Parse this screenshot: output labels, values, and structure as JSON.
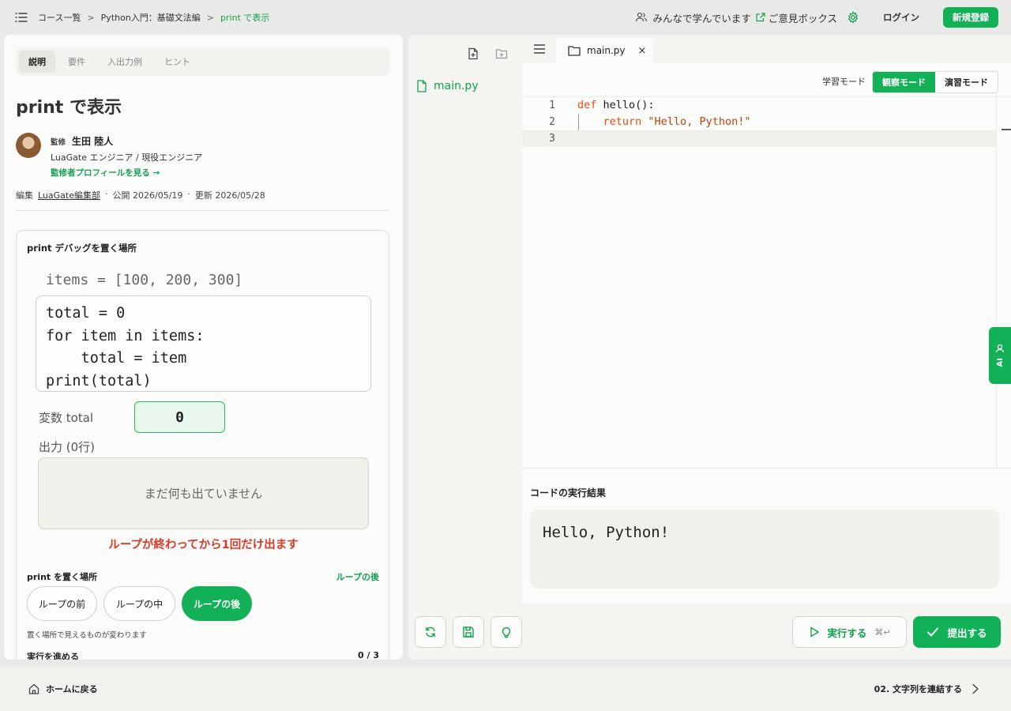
{
  "breadcrumb": {
    "items": [
      "コース一覧",
      "Python入門：基礎文法編"
    ],
    "current": "print で表示"
  },
  "header": {
    "community": "みんなで学んでいます",
    "feedback": "ご意見ボックス",
    "login": "ログイン",
    "signup": "新規登録",
    "accent": "#12b157"
  },
  "lesson": {
    "tabs": [
      "説明",
      "要件",
      "入出力例",
      "ヒント"
    ],
    "active_tab": "説明",
    "title": "print で表示",
    "supervisor": {
      "label": "監修",
      "name": "生田 陸人",
      "role": "LuaGate エンジニア / 現役エンジニア",
      "profile_link": "監修者プロフィールを見る →"
    },
    "meta": {
      "editor_label": "編集",
      "editor": "LuaGate編集部",
      "published": "公開 2026/05/19",
      "updated": "更新 2026/05/28",
      "dot": "·"
    }
  },
  "demo": {
    "title": "print デバッグを置く場所",
    "pre_line": "items = [100, 200, 300]",
    "code_lines": [
      "total = 0",
      "for item in items:",
      "    total = item",
      "print(total)"
    ],
    "var_label": "変数 total",
    "var_value": "0",
    "output_label": "出力 (0行)",
    "output_empty": "まだ何も出ていません",
    "note": "ループが終わってから1回だけ出ます",
    "place_label": "print を置く場所",
    "place_value": "ループの後",
    "place_options": [
      "ループの前",
      "ループの中",
      "ループの後"
    ],
    "place_hint": "置く場所で見えるものが変わります",
    "step_label": "実行を進める",
    "step_count": "0 / 3"
  },
  "editor": {
    "file_name": "main.py",
    "tab_close": "×",
    "mode_label": "学習モード",
    "modes": [
      "観察モード",
      "演習モード"
    ],
    "active_mode": "観察モード",
    "lines": [
      {
        "n": "1",
        "parts": [
          [
            "kw",
            "def "
          ],
          [
            "fn",
            "hello():"
          ]
        ]
      },
      {
        "n": "2",
        "parts": [
          [
            "fn",
            "    "
          ],
          [
            "kw",
            "return "
          ],
          [
            "str",
            "\"Hello, Python!\""
          ]
        ]
      },
      {
        "n": "3",
        "parts": []
      }
    ],
    "result_title": "コードの実行結果",
    "result_output": "Hello, Python!",
    "run_label": "実行する",
    "run_shortcut": "⌘↵",
    "submit_label": "提出する",
    "ai_label": "AI"
  },
  "footer": {
    "home": "ホームに戻る",
    "next": "02. 文字列を連結する"
  }
}
